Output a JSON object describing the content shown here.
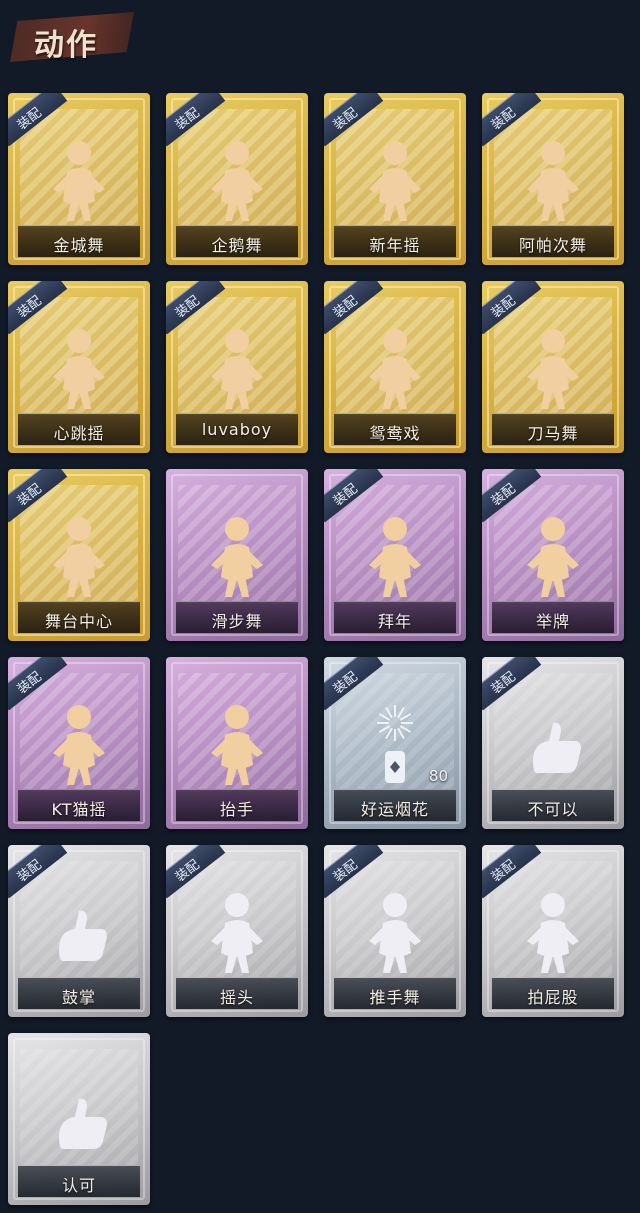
{
  "header": {
    "title": "动作"
  },
  "badge_label": "装配",
  "actions": [
    {
      "label": "金城舞",
      "tier": "gold",
      "equipped": true,
      "icon": "dance-figure-icon"
    },
    {
      "label": "企鹅舞",
      "tier": "gold",
      "equipped": true,
      "icon": "dance-figure-icon"
    },
    {
      "label": "新年摇",
      "tier": "gold",
      "equipped": true,
      "icon": "dance-figure-icon"
    },
    {
      "label": "阿帕次舞",
      "tier": "gold",
      "equipped": true,
      "icon": "dance-figure-icon"
    },
    {
      "label": "心跳摇",
      "tier": "gold",
      "equipped": true,
      "icon": "dance-figure-icon"
    },
    {
      "label": "luvaboy",
      "tier": "gold",
      "equipped": true,
      "icon": "dance-figure-icon"
    },
    {
      "label": "鸳鸯戏",
      "tier": "gold",
      "equipped": true,
      "icon": "dance-figure-icon"
    },
    {
      "label": "刀马舞",
      "tier": "gold",
      "equipped": true,
      "icon": "dance-figure-icon"
    },
    {
      "label": "舞台中心",
      "tier": "gold",
      "equipped": true,
      "icon": "dance-figure-icon"
    },
    {
      "label": "滑步舞",
      "tier": "purple",
      "equipped": false,
      "icon": "dance-figure-icon"
    },
    {
      "label": "拜年",
      "tier": "purple",
      "equipped": true,
      "icon": "bow-figure-icon"
    },
    {
      "label": "举牌",
      "tier": "purple",
      "equipped": true,
      "icon": "sign-figure-icon"
    },
    {
      "label": "KT猫摇",
      "tier": "purple",
      "equipped": true,
      "icon": "dance-figure-icon"
    },
    {
      "label": "抬手",
      "tier": "purple",
      "equipped": false,
      "icon": "raise-hand-icon"
    },
    {
      "label": "好运烟花",
      "tier": "blue",
      "equipped": true,
      "icon": "firework-icon",
      "count": "80"
    },
    {
      "label": "不可以",
      "tier": "gray",
      "equipped": true,
      "icon": "finger-wag-icon"
    },
    {
      "label": "鼓掌",
      "tier": "gray",
      "equipped": true,
      "icon": "clap-icon"
    },
    {
      "label": "摇头",
      "tier": "gray",
      "equipped": true,
      "icon": "shake-head-icon"
    },
    {
      "label": "推手舞",
      "tier": "gray",
      "equipped": true,
      "icon": "push-hand-icon"
    },
    {
      "label": "拍屁股",
      "tier": "gray",
      "equipped": true,
      "icon": "pat-icon"
    },
    {
      "label": "认可",
      "tier": "gray",
      "equipped": false,
      "icon": "thumbs-up-icon"
    }
  ]
}
